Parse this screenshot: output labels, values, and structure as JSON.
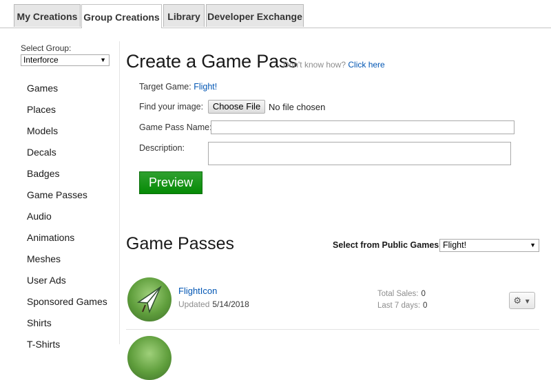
{
  "tabs": [
    {
      "label": "My Creations",
      "active": false
    },
    {
      "label": "Group Creations",
      "active": true
    },
    {
      "label": "Library",
      "active": false
    },
    {
      "label": "Developer Exchange",
      "active": false
    }
  ],
  "sidebar": {
    "select_label": "Select Group:",
    "selected_group": "Interforce",
    "items": [
      "Games",
      "Places",
      "Models",
      "Decals",
      "Badges",
      "Game Passes",
      "Audio",
      "Animations",
      "Meshes",
      "User Ads",
      "Sponsored Games",
      "Shirts",
      "T-Shirts"
    ]
  },
  "form": {
    "title": "Create a Game Pass",
    "howto_text": "Don't know how?",
    "howto_link": "Click here",
    "target_label": "Target Game:",
    "target_value": "Flight!",
    "image_label": "Find your image:",
    "file_button": "Choose File",
    "file_status": "No file chosen",
    "name_label": "Game Pass Name:",
    "name_value": "",
    "desc_label": "Description:",
    "desc_value": "",
    "preview_button": "Preview"
  },
  "passes": {
    "title": "Game Passes",
    "select_label": "Select from Public Games:",
    "selected_game": "Flight!",
    "items": [
      {
        "name": "FlightIcon",
        "updated_label": "Updated",
        "updated_date": "5/14/2018",
        "total_sales_label": "Total Sales:",
        "total_sales": "0",
        "last7_label": "Last 7 days:",
        "last7": "0"
      }
    ]
  },
  "icons": {
    "settings": "gear-icon",
    "dropdown": "chevron-down-icon",
    "pass_image": "paper-plane-icon"
  }
}
